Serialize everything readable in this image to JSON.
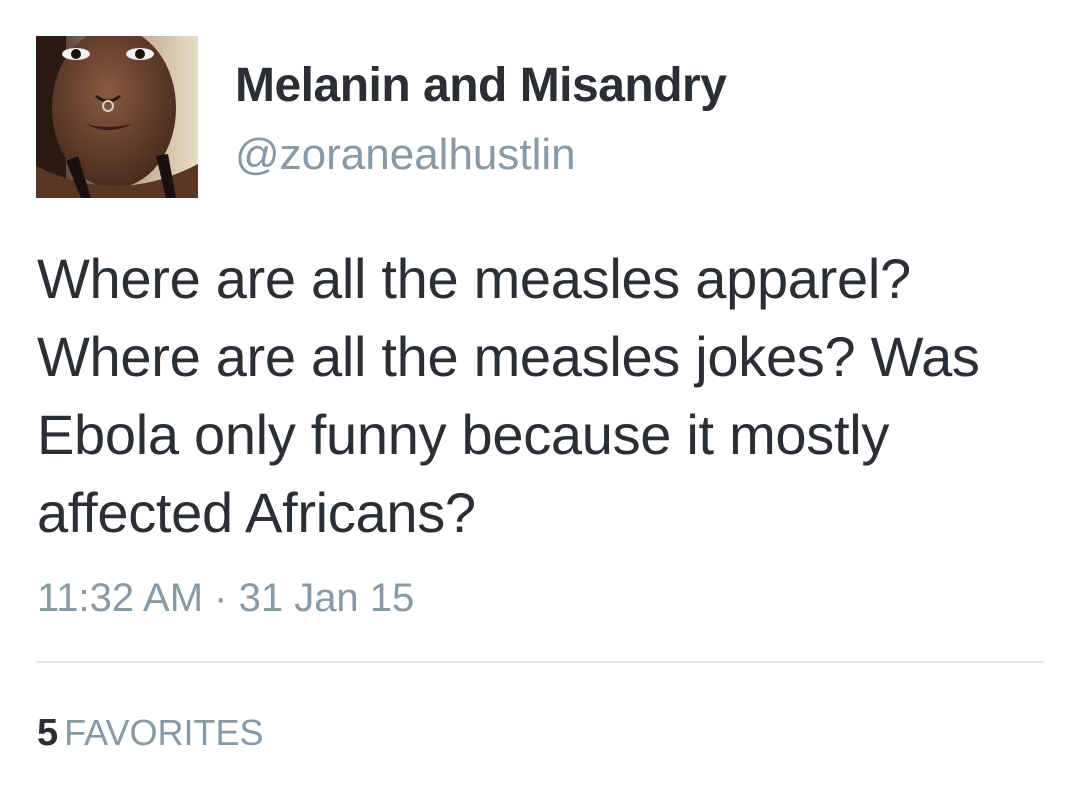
{
  "tweet": {
    "author": {
      "display_name": "Melanin and Misandry",
      "handle": "@zoranealhustlin"
    },
    "text": "Where are all the measles apparel? Where are all the measles jokes? Was Ebola only funny because it mostly affected Africans?",
    "timestamp": "11:32 AM · 31 Jan 15",
    "stats": {
      "favorites_count": "5",
      "favorites_label": "FAVORITES"
    }
  },
  "colors": {
    "text_primary": "#292f33",
    "text_secondary": "#8899a6",
    "divider": "#e1e8ed",
    "background": "#ffffff"
  }
}
